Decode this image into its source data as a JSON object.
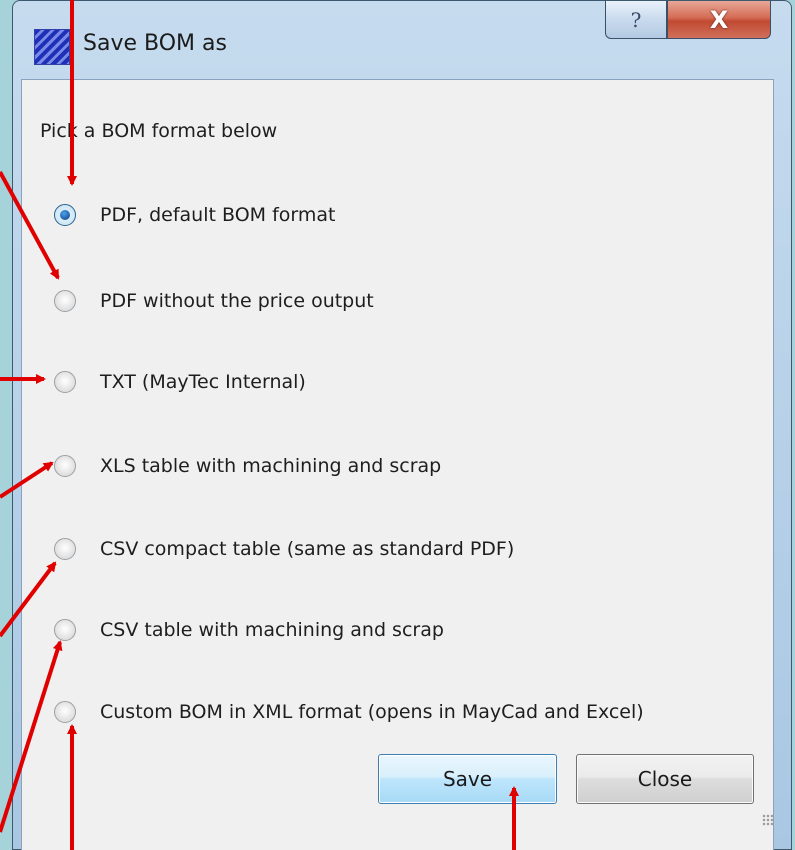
{
  "window": {
    "title": "Save BOM as"
  },
  "titlebar": {
    "help_glyph": "?",
    "close_glyph": "X"
  },
  "dialog": {
    "prompt": "Pick a BOM format below",
    "options": [
      {
        "label": "PDF, default BOM format",
        "checked": true
      },
      {
        "label": "PDF without the price output",
        "checked": false
      },
      {
        "label": "TXT (MayTec Internal)",
        "checked": false
      },
      {
        "label": "XLS table with machining and scrap",
        "checked": false
      },
      {
        "label": "CSV compact table (same as standard PDF)",
        "checked": false
      },
      {
        "label": "CSV table with machining and scrap",
        "checked": false
      },
      {
        "label": "Custom BOM in XML format (opens in MayCad and Excel)",
        "checked": false
      }
    ]
  },
  "buttons": {
    "save": "Save",
    "close": "Close"
  },
  "colors": {
    "annotation_arrow": "#e00000",
    "background": "#a6d3d9"
  }
}
